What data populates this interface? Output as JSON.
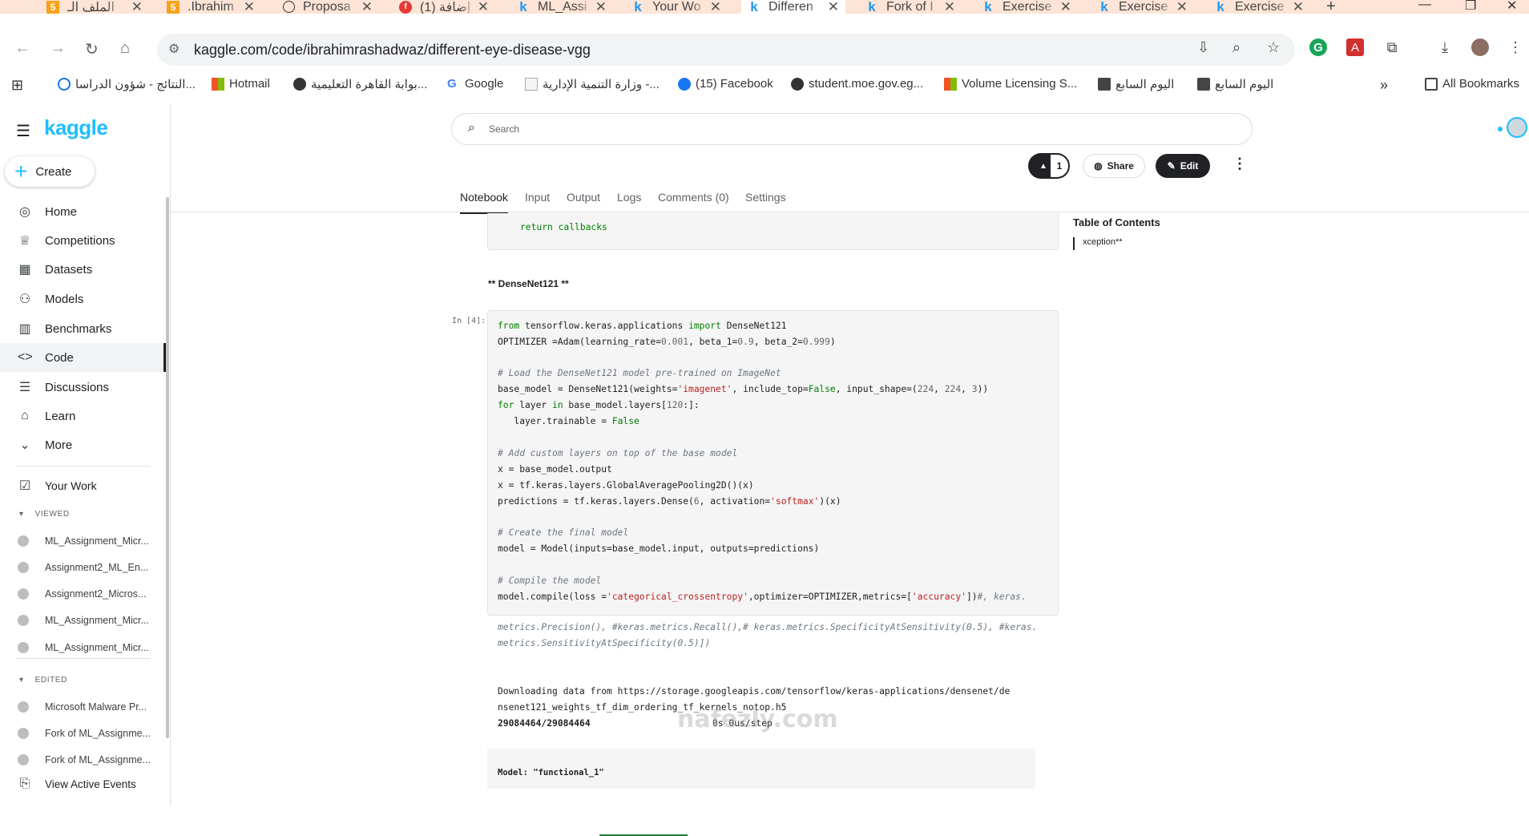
{
  "browser": {
    "tabs": [
      {
        "title": "الملف الـ",
        "icon": "five-icon"
      },
      {
        "title": ".Ibrahim",
        "icon": "five-icon"
      },
      {
        "title": "Proposa",
        "icon": "chatgpt-icon"
      },
      {
        "title": "(1) إضافة",
        "icon": "facebook-icon"
      },
      {
        "title": "ML_Assi",
        "icon": "kaggle-icon"
      },
      {
        "title": "Your Wo",
        "icon": "kaggle-icon"
      },
      {
        "title": "Differen",
        "icon": "kaggle-icon",
        "active": true
      },
      {
        "title": "Fork of I",
        "icon": "kaggle-icon"
      },
      {
        "title": "Exercise",
        "icon": "kaggle-icon"
      },
      {
        "title": "Exercise",
        "icon": "kaggle-icon"
      },
      {
        "title": "Exercise",
        "icon": "kaggle-icon"
      }
    ],
    "url": "kaggle.com/code/ibrahimrashadwaz/different-eye-disease-vgg",
    "bookmarks": [
      "النتائج - شؤون الدراسا...",
      "Hotmail",
      "بوابة القاهرة التعليمية...",
      "Google",
      "وزارة التنمية الإدارية -...",
      "(15) Facebook",
      "student.moe.gov.eg...",
      "Volume Licensing S...",
      "اليوم السابع",
      "اليوم السابع"
    ],
    "more_bookmarks": "»",
    "all_bookmarks": "All Bookmarks"
  },
  "kaggle": {
    "logo": "kaggle",
    "create_label": "Create",
    "nav": [
      {
        "label": "Home",
        "icon": "compass-icon"
      },
      {
        "label": "Competitions",
        "icon": "trophy-icon"
      },
      {
        "label": "Datasets",
        "icon": "table-icon"
      },
      {
        "label": "Models",
        "icon": "models-icon"
      },
      {
        "label": "Benchmarks",
        "icon": "bar-chart-icon"
      },
      {
        "label": "Code",
        "icon": "code-icon",
        "active": true
      },
      {
        "label": "Discussions",
        "icon": "discussion-icon"
      },
      {
        "label": "Learn",
        "icon": "school-icon"
      },
      {
        "label": "More",
        "icon": "chevron-down-icon"
      }
    ],
    "your_work": "Your Work",
    "viewed_header": "VIEWED",
    "viewed": [
      "ML_Assignment_Micr...",
      "Assignment2_ML_En...",
      "Assignment2_Micros...",
      "ML_Assignment_Micr...",
      "ML_Assignment_Micr..."
    ],
    "edited_header": "EDITED",
    "edited": [
      "Microsoft Malware Pr...",
      "Fork of ML_Assignme...",
      "Fork of ML_Assignme..."
    ],
    "view_active_events": "View Active Events",
    "search_placeholder": "Search",
    "vote_count": "1",
    "share_label": "Share",
    "edit_label": "Edit",
    "tabs": [
      "Notebook",
      "Input",
      "Output",
      "Logs",
      "Comments (0)",
      "Settings"
    ],
    "active_tab": "Notebook",
    "prev_cell_code": "return callbacks",
    "section_heading": "** DenseNet121 **",
    "cell_prompt": "In [4]:",
    "output_lines": [
      "Downloading data from https://storage.googleapis.com/tensorflow/keras-applications/densenet/de",
      "nsenet121_weights_tf_dim_ordering_tf_kernels_notop.h5",
      "29084464/29084464",
      "0s 0us/step"
    ],
    "model_summary_line": "Model: \"functional_1\"",
    "toc_title": "Table of Contents",
    "toc_items": [
      "xception**"
    ],
    "watermark": "nafezly.com"
  }
}
